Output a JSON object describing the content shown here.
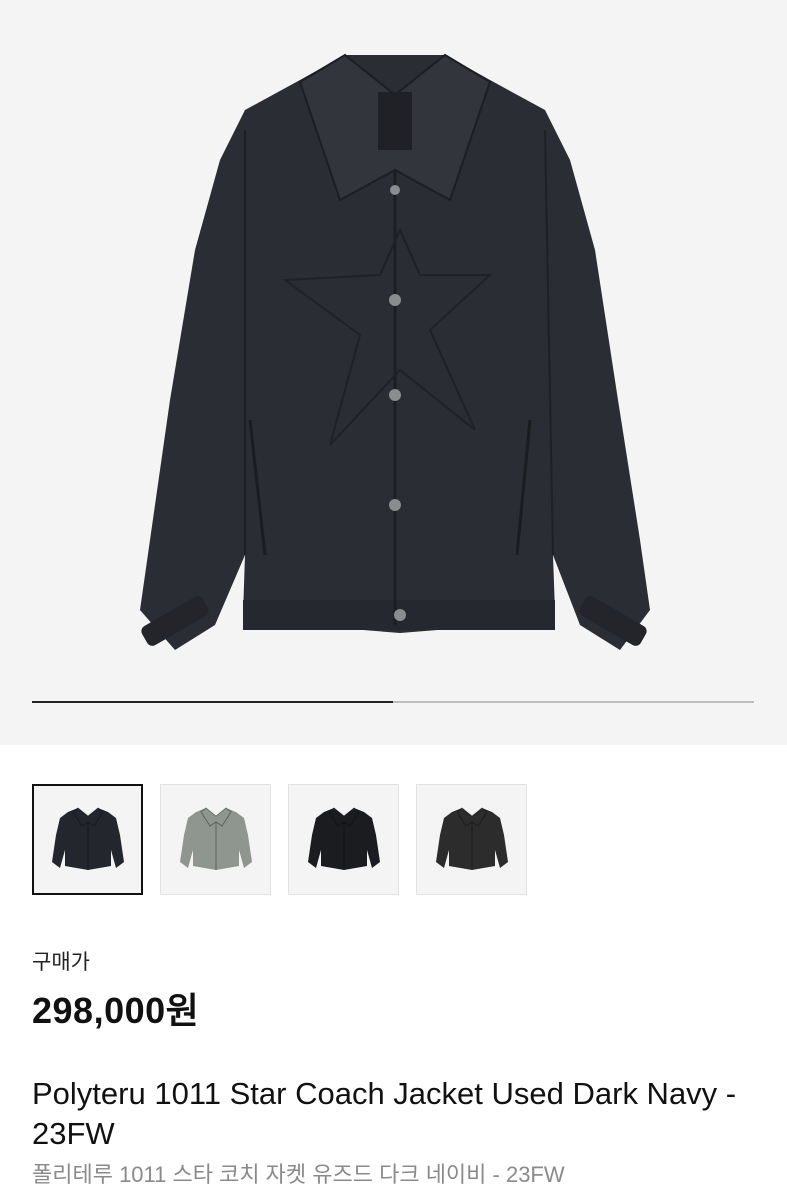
{
  "gallery": {
    "progress": 0.5,
    "thumbnails": [
      {
        "name": "thumb-dark-navy",
        "color": "#23262d",
        "selected": true
      },
      {
        "name": "thumb-grey",
        "color": "#8f968f",
        "selected": false
      },
      {
        "name": "thumb-black",
        "color": "#1b1c20",
        "selected": false
      },
      {
        "name": "thumb-charcoal",
        "color": "#2c2c2c",
        "selected": false
      }
    ]
  },
  "product": {
    "price_label": "구매가",
    "price": "298,000원",
    "title": "Polyteru 1011 Star Coach Jacket Used Dark Navy - 23FW",
    "subtitle": "폴리테루 1011 스타 코치 자켓 유즈드 다크 네이비 - 23FW"
  },
  "colors": {
    "jacket": "#2a2d34",
    "hero_bg": "#f4f4f4"
  }
}
